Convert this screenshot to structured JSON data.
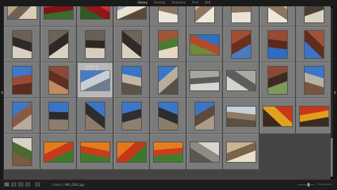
{
  "topbar": {
    "tabs": [
      {
        "label": "Library",
        "active": true
      },
      {
        "label": "Develop",
        "active": false
      },
      {
        "label": "Slideshow",
        "active": false
      },
      {
        "label": "Print",
        "active": false
      },
      {
        "label": "Web",
        "active": false
      }
    ]
  },
  "grid": {
    "cells": [
      {
        "index": "",
        "selected": false,
        "photo": {
          "kind": "landscape",
          "colors": [
            "#b9a488",
            "#6f6253",
            "#d9cdb6"
          ]
        }
      },
      {
        "index": "",
        "selected": false,
        "photo": {
          "kind": "landscape",
          "colors": [
            "#d22a2a",
            "#7d1515",
            "#3a6b2a"
          ]
        }
      },
      {
        "index": "",
        "selected": false,
        "photo": {
          "kind": "landscape",
          "colors": [
            "#d52c2c",
            "#8e1717",
            "#2f5a24"
          ]
        }
      },
      {
        "index": "",
        "selected": false,
        "photo": {
          "kind": "landscape",
          "colors": [
            "#8fa2b8",
            "#e8e2d5",
            "#5b4a3b"
          ]
        }
      },
      {
        "index": "",
        "selected": false,
        "photo": {
          "kind": "portrait",
          "colors": [
            "#c8b59b",
            "#8a7660",
            "#efe7da"
          ]
        }
      },
      {
        "index": "",
        "selected": false,
        "photo": {
          "kind": "portrait",
          "colors": [
            "#c7b49a",
            "#8b7762",
            "#f0e8db"
          ]
        }
      },
      {
        "index": "",
        "selected": false,
        "photo": {
          "kind": "portrait",
          "colors": [
            "#c4b096",
            "#87735d",
            "#ebe3d6"
          ]
        }
      },
      {
        "index": "",
        "selected": false,
        "photo": {
          "kind": "portrait",
          "colors": [
            "#c8b59b",
            "#8a7660",
            "#efe7da"
          ]
        }
      },
      {
        "index": "",
        "selected": false,
        "photo": {
          "kind": "portrait",
          "colors": [
            "#9a8a76",
            "#4b4036",
            "#dcd3c3"
          ]
        }
      },
      {
        "index": "",
        "selected": false,
        "photo": {
          "kind": "portrait",
          "colors": [
            "#6b6055",
            "#2f2a25",
            "#d8cfc0"
          ]
        }
      },
      {
        "index": "",
        "selected": false,
        "photo": {
          "kind": "portrait",
          "colors": [
            "#6d6257",
            "#2e2924",
            "#dbd1c2"
          ]
        }
      },
      {
        "index": "",
        "selected": false,
        "photo": {
          "kind": "portrait",
          "colors": [
            "#6a5f54",
            "#2d2823",
            "#d6ccbd"
          ]
        }
      },
      {
        "index": "",
        "selected": false,
        "photo": {
          "kind": "portrait",
          "colors": [
            "#6e6358",
            "#302b26",
            "#dad0c1"
          ]
        }
      },
      {
        "index": "",
        "selected": false,
        "photo": {
          "kind": "portrait",
          "colors": [
            "#a0563b",
            "#4d7a32",
            "#e6d9c4"
          ]
        }
      },
      {
        "index": "",
        "selected": false,
        "photo": {
          "kind": "landscape",
          "colors": [
            "#2f6fc2",
            "#b34a2c",
            "#6f8a3c"
          ]
        }
      },
      {
        "index": "",
        "selected": false,
        "photo": {
          "kind": "portrait",
          "colors": [
            "#a24e34",
            "#6b2f1f",
            "#4a7bc0"
          ]
        }
      },
      {
        "index": "",
        "selected": false,
        "photo": {
          "kind": "portrait",
          "colors": [
            "#9a4a31",
            "#5a2a1b",
            "#2f6cc0"
          ]
        }
      },
      {
        "index": "",
        "selected": false,
        "photo": {
          "kind": "portrait",
          "colors": [
            "#a05338",
            "#5f2d1e",
            "#3a75c8"
          ]
        }
      },
      {
        "index": "",
        "selected": false,
        "photo": {
          "kind": "portrait",
          "colors": [
            "#3f78c8",
            "#9c4a33",
            "#5b2b1c"
          ]
        }
      },
      {
        "index": "",
        "selected": false,
        "photo": {
          "kind": "portrait",
          "colors": [
            "#8a4a35",
            "#5e2f21",
            "#c28a60"
          ]
        }
      },
      {
        "index": "201",
        "selected": true,
        "photo": {
          "kind": "landscape",
          "colors": [
            "#4a7bc0",
            "#c9ced6",
            "#6e7d90"
          ]
        }
      },
      {
        "index": "",
        "selected": false,
        "photo": {
          "kind": "portrait",
          "colors": [
            "#3a74c6",
            "#c2b7a5",
            "#5e5446"
          ]
        }
      },
      {
        "index": "",
        "selected": false,
        "photo": {
          "kind": "portrait",
          "colors": [
            "#3c76c8",
            "#b9ae9c",
            "#595045"
          ]
        }
      },
      {
        "index": "",
        "selected": false,
        "photo": {
          "kind": "landscape",
          "colors": [
            "#a9a6a2",
            "#5d5c59",
            "#d7d5d1"
          ]
        }
      },
      {
        "index": "",
        "selected": false,
        "photo": {
          "kind": "landscape",
          "colors": [
            "#aba8a4",
            "#5e5d5a",
            "#d5d3cf"
          ]
        }
      },
      {
        "index": "",
        "selected": false,
        "photo": {
          "kind": "portrait",
          "colors": [
            "#8a4a35",
            "#3d2a22",
            "#7e9a5a"
          ]
        }
      },
      {
        "index": "",
        "selected": false,
        "photo": {
          "kind": "portrait",
          "colors": [
            "#3b77c9",
            "#b8b1a6",
            "#7b5440"
          ]
        }
      },
      {
        "index": "",
        "selected": false,
        "photo": {
          "kind": "portrait",
          "colors": [
            "#3f78c8",
            "#8a5b44",
            "#b4ab9c"
          ]
        }
      },
      {
        "index": "",
        "selected": false,
        "photo": {
          "kind": "portrait",
          "colors": [
            "#3a74c6",
            "#2b2b2b",
            "#8c7e6c"
          ]
        }
      },
      {
        "index": "",
        "selected": false,
        "photo": {
          "kind": "portrait",
          "colors": [
            "#3b75c7",
            "#2d2d2d",
            "#8a7c6a"
          ]
        }
      },
      {
        "index": "",
        "selected": false,
        "photo": {
          "kind": "portrait",
          "colors": [
            "#3d77c9",
            "#2f2f2f",
            "#8e806e"
          ]
        }
      },
      {
        "index": "",
        "selected": false,
        "photo": {
          "kind": "portrait",
          "colors": [
            "#3c76c8",
            "#2c2c2c",
            "#8b7d6b"
          ]
        }
      },
      {
        "index": "",
        "selected": false,
        "photo": {
          "kind": "portrait",
          "colors": [
            "#3b75c7",
            "#5e4a3b",
            "#a89b88"
          ]
        }
      },
      {
        "index": "",
        "selected": false,
        "photo": {
          "kind": "landscape",
          "colors": [
            "#c9cfd8",
            "#8a7a66",
            "#5d4f41"
          ]
        }
      },
      {
        "index": "",
        "selected": false,
        "photo": {
          "kind": "landscape",
          "colors": [
            "#c63a1a",
            "#e0a020",
            "#3a2a1e"
          ]
        }
      },
      {
        "index": "",
        "selected": false,
        "photo": {
          "kind": "landscape",
          "colors": [
            "#c43818",
            "#df9e1e",
            "#3b2b1f"
          ]
        }
      },
      {
        "index": "",
        "selected": false,
        "photo": {
          "kind": "portrait",
          "colors": [
            "#d8d2c8",
            "#4a6a30",
            "#7a5a42"
          ]
        }
      },
      {
        "index": "",
        "selected": false,
        "photo": {
          "kind": "landscape",
          "colors": [
            "#e27a1a",
            "#c63a1a",
            "#3c7a2a"
          ]
        }
      },
      {
        "index": "",
        "selected": false,
        "photo": {
          "kind": "landscape",
          "colors": [
            "#e47c1c",
            "#c83c1c",
            "#3e7c2c"
          ]
        }
      },
      {
        "index": "",
        "selected": false,
        "photo": {
          "kind": "landscape",
          "colors": [
            "#e2781a",
            "#c43818",
            "#3a782a"
          ]
        }
      },
      {
        "index": "",
        "selected": false,
        "photo": {
          "kind": "landscape",
          "colors": [
            "#e67e1e",
            "#ca3e1e",
            "#407e2e"
          ]
        }
      },
      {
        "index": "",
        "selected": false,
        "photo": {
          "kind": "landscape",
          "colors": [
            "#d9d6d0",
            "#8f8b84",
            "#5a5650"
          ]
        }
      },
      {
        "index": "",
        "selected": false,
        "photo": {
          "kind": "landscape",
          "colors": [
            "#c9b490",
            "#7a6448",
            "#e9dfcb"
          ]
        }
      },
      {
        "index": "",
        "selected": false,
        "empty": true
      },
      {
        "index": "",
        "selected": false,
        "empty": true
      }
    ]
  },
  "bottombar": {
    "prefix": "Folders",
    "filename": "IMG_0201.jpg",
    "thumb_label": "Thumbnails"
  }
}
